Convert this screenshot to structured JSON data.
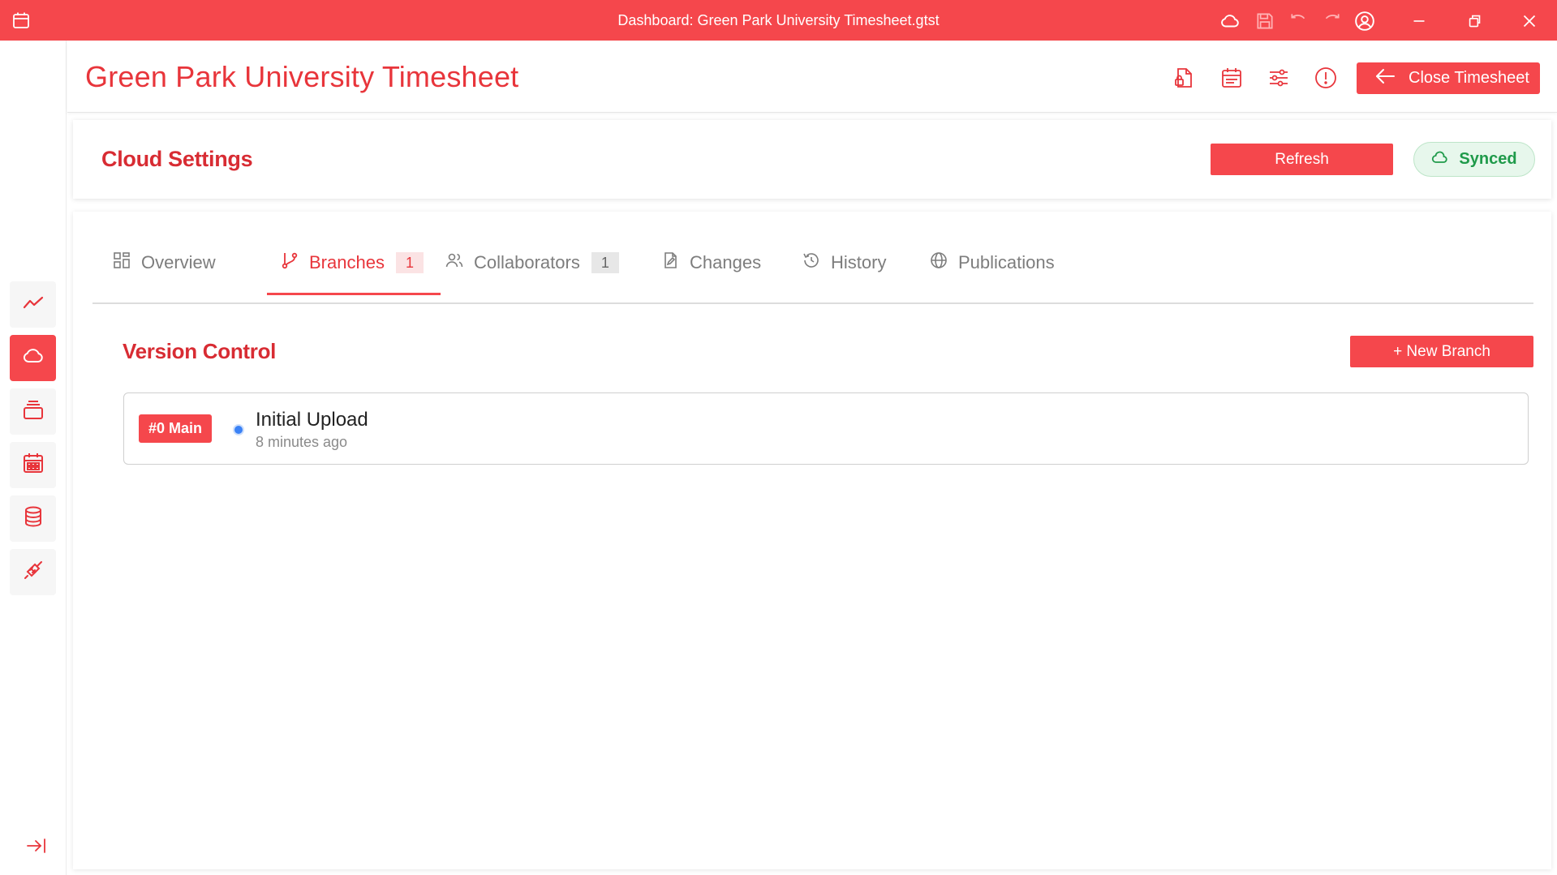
{
  "window": {
    "title": "Dashboard: Green Park University Timesheet.gtst",
    "controls": [
      "cloud-icon",
      "save-icon",
      "undo-icon",
      "redo-icon",
      "account-icon",
      "minimize-icon",
      "restore-icon",
      "close-icon"
    ]
  },
  "rail": {
    "items": [
      {
        "icon": "trend-icon",
        "active": false
      },
      {
        "icon": "cloud-icon",
        "active": true
      },
      {
        "icon": "stack-icon",
        "active": false
      },
      {
        "icon": "calendar-grid-icon",
        "active": false
      },
      {
        "icon": "database-icon",
        "active": false
      },
      {
        "icon": "plug-icon",
        "active": false
      }
    ],
    "collapse_icon": "collapse-right-icon"
  },
  "header": {
    "title": "Green Park University Timesheet",
    "actions": [
      "document-lock-icon",
      "calendar-icon",
      "sliders-icon",
      "alert-circle-icon"
    ],
    "close_label": "Close Timesheet"
  },
  "cloud_settings": {
    "title": "Cloud Settings",
    "refresh_label": "Refresh",
    "status_label": "Synced"
  },
  "tabs": [
    {
      "label": "Overview",
      "icon": "grid-icon",
      "count": null,
      "active": false
    },
    {
      "label": "Branches",
      "icon": "branch-icon",
      "count": "1",
      "active": true
    },
    {
      "label": "Collaborators",
      "icon": "users-icon",
      "count": "1",
      "active": false
    },
    {
      "label": "Changes",
      "icon": "file-edit-icon",
      "count": null,
      "active": false
    },
    {
      "label": "History",
      "icon": "history-icon",
      "count": null,
      "active": false
    },
    {
      "label": "Publications",
      "icon": "globe-icon",
      "count": null,
      "active": false
    }
  ],
  "version_control": {
    "title": "Version Control",
    "new_branch_label": "+ New Branch",
    "branches": [
      {
        "badge": "#0 Main",
        "message": "Initial Upload",
        "time": "8 minutes ago"
      }
    ]
  },
  "colors": {
    "accent": "#f5474c",
    "accent_text": "#e8353b",
    "synced_green": "#1f9a4a",
    "status_dot": "#3b82f6"
  }
}
